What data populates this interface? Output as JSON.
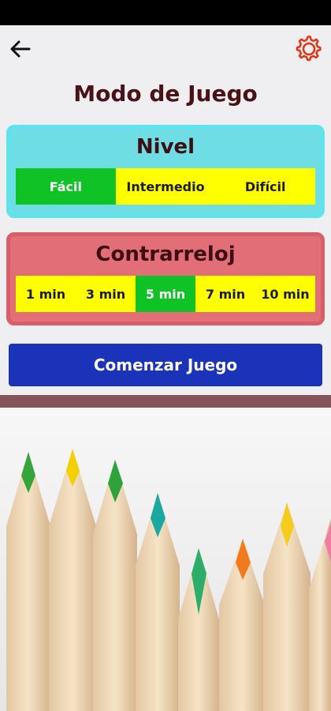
{
  "header": {
    "back_icon": "arrow-left-icon",
    "settings_icon": "gear-icon",
    "settings_color": "#e8300e"
  },
  "page": {
    "title": "Modo de Juego"
  },
  "nivel": {
    "title": "Nivel",
    "options": [
      "Fácil",
      "Intermedio",
      "Difícil"
    ],
    "selected": "Fácil"
  },
  "contrarreloj": {
    "title": "Contrarreloj",
    "options": [
      "1 min",
      "3 min",
      "5 min",
      "7 min",
      "10 min"
    ],
    "selected": "5 min"
  },
  "start_button": {
    "label": "Comenzar Juego"
  },
  "colors": {
    "selected": "#0fc225",
    "unselected": "#ffff00",
    "button": "#1a33b8",
    "title_text": "#4a1216"
  },
  "illustration": {
    "subject": "colored pencils"
  }
}
